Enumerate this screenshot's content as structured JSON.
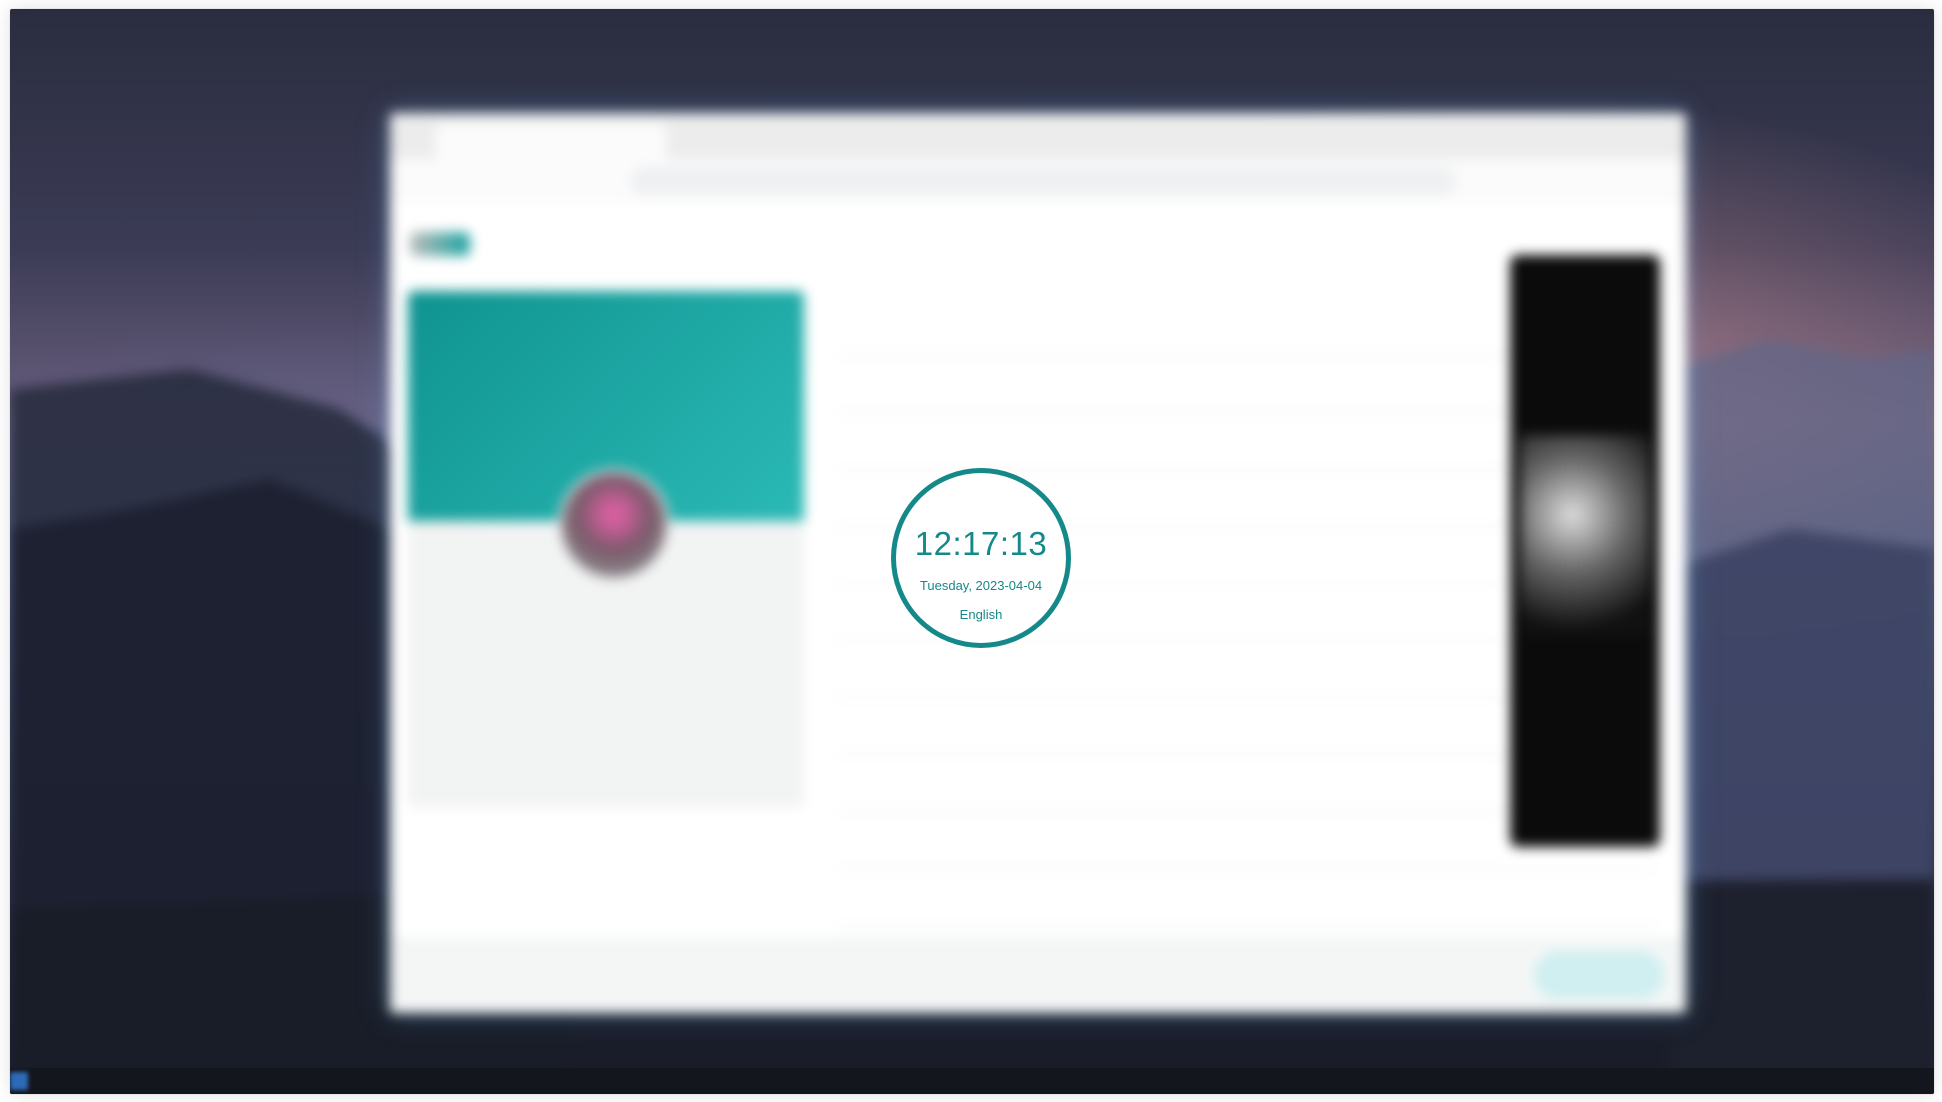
{
  "clock": {
    "time": "12:17:13",
    "date": "Tuesday, 2023-04-04",
    "language": "English",
    "accent_color": "#15898a"
  },
  "desktop": {
    "wallpaper": "mountain-dusk",
    "blurred": true
  },
  "browser": {
    "blurred": true,
    "tab_title": "",
    "url": "",
    "nav_items": [
      "",
      "",
      "",
      "",
      ""
    ],
    "profile": {
      "name": "",
      "bio": "",
      "more_label": ""
    },
    "articles": [
      "",
      "",
      "",
      "",
      "",
      "",
      "",
      "",
      "",
      "",
      ""
    ],
    "ad": {
      "title": ""
    }
  }
}
